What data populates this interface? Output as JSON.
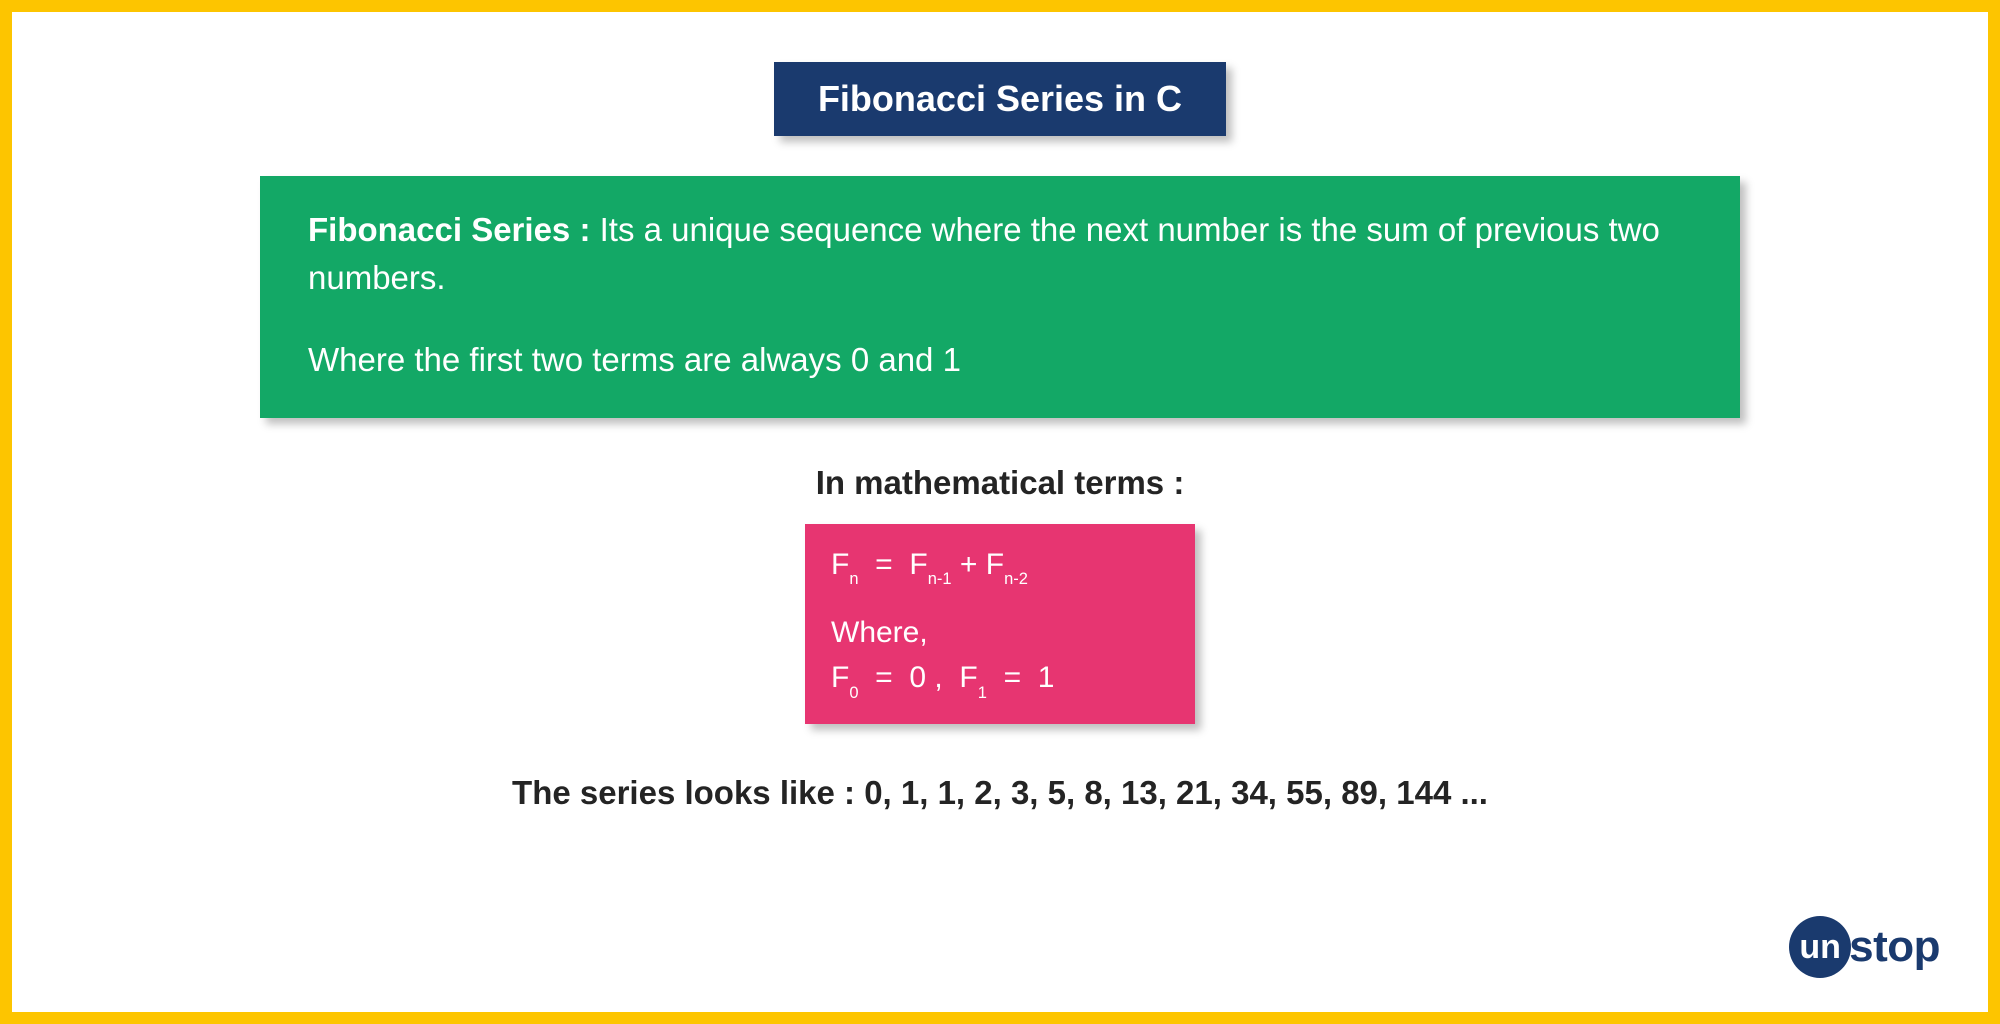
{
  "title": "Fibonacci Series in C",
  "definition": {
    "label": "Fibonacci Series :",
    "text1": " Its a unique sequence where the next number is the sum of previous two numbers.",
    "text2": "Where the first two terms are always 0 and 1"
  },
  "math_label": "In mathematical terms :",
  "formula": {
    "where": "Where,"
  },
  "series_label": "The series looks like : ",
  "series_values": "0, 1, 1, 2, 3, 5, 8, 13, 21, 34, 55, 89, 144 ...",
  "logo": {
    "circle": "un",
    "rest": "stop"
  },
  "colors": {
    "border": "#FDC500",
    "title_bg": "#1A3A6E",
    "definition_bg": "#13A866",
    "formula_bg": "#E73571",
    "text_dark": "#242424"
  }
}
